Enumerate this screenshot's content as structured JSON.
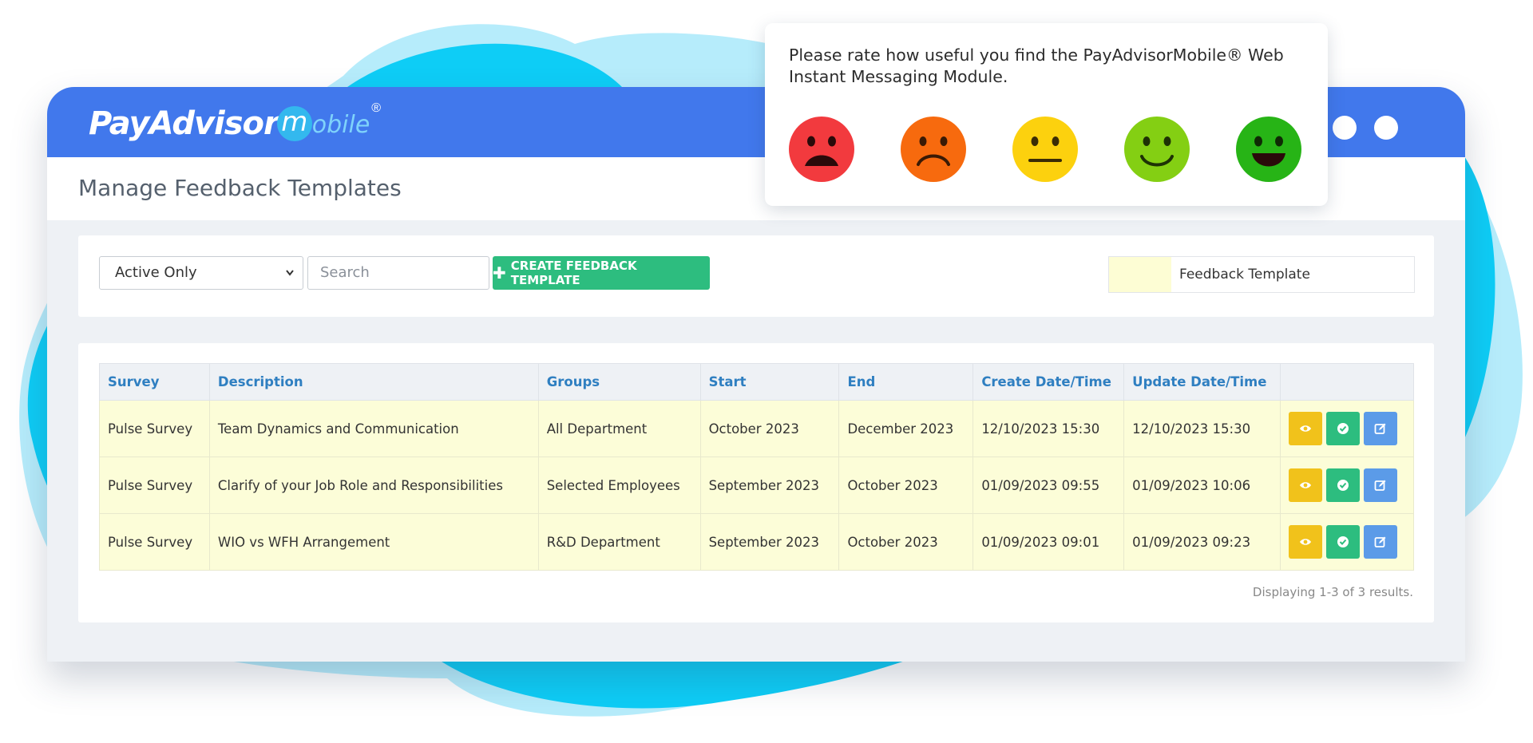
{
  "rating": {
    "prompt": "Please rate how useful you find the PayAdvisorMobile® Web Instant Messaging Module.",
    "faces": [
      {
        "name": "very-sad",
        "color": "#f23a3e"
      },
      {
        "name": "sad",
        "color": "#f76a0e"
      },
      {
        "name": "neutral",
        "color": "#fcd10e"
      },
      {
        "name": "happy",
        "color": "#84cf13"
      },
      {
        "name": "very-happy",
        "color": "#27b416"
      }
    ]
  },
  "header": {
    "logo_pay": "PayAdvisor",
    "logo_m": "m",
    "logo_obile": "obile",
    "logo_reg": "®",
    "accent": "#4178ec"
  },
  "page": {
    "title": "Manage Feedback Templates"
  },
  "filters": {
    "status_selected": "Active Only",
    "search_placeholder": "Search",
    "create_label": "CREATE FEEDBACK TEMPLATE",
    "legend_label": "Feedback Template",
    "legend_color": "#fdfdd4"
  },
  "table": {
    "headers": [
      "Survey",
      "Description",
      "Groups",
      "Start",
      "End",
      "Create Date/Time",
      "Update Date/Time",
      ""
    ],
    "rows": [
      {
        "survey": "Pulse Survey",
        "description": "Team Dynamics and Communication",
        "groups": "All Department",
        "start": "October 2023",
        "end": "December 2023",
        "created": "12/10/2023 15:30",
        "updated": "12/10/2023 15:30"
      },
      {
        "survey": "Pulse Survey",
        "description": "Clarify of your Job Role and Responsibilities",
        "groups": "Selected Employees",
        "start": "September 2023",
        "end": "October 2023",
        "created": "01/09/2023 09:55",
        "updated": "01/09/2023 10:06"
      },
      {
        "survey": "Pulse Survey",
        "description": "WIO vs WFH Arrangement",
        "groups": "R&D Department",
        "start": "September 2023",
        "end": "October 2023",
        "created": "01/09/2023 09:01",
        "updated": "01/09/2023 09:23"
      }
    ],
    "result_text": "Displaying 1-3 of 3 results."
  }
}
